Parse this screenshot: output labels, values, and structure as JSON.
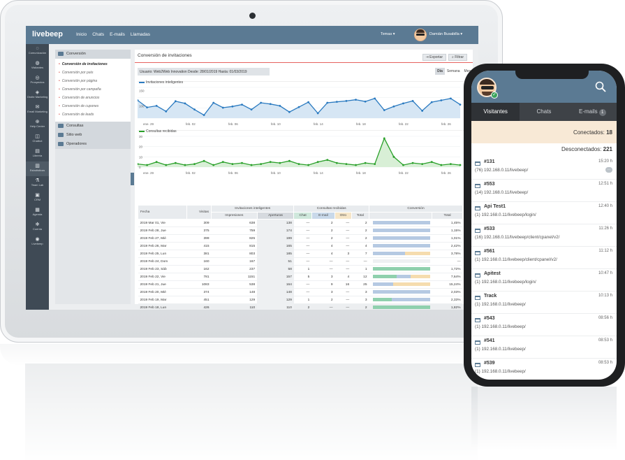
{
  "app": {
    "brand": "livebeep",
    "nav": [
      "Inicio",
      "Chats",
      "E-mails",
      "Llamadas"
    ],
    "temas": "Temas",
    "user": "Damián Busabilla"
  },
  "sidenav": [
    {
      "label": "Comunicación",
      "icon": "chat-bubble-icon"
    },
    {
      "label": "Visitantes",
      "icon": "users-icon"
    },
    {
      "label": "Prospectos",
      "icon": "people-icon"
    },
    {
      "label": "Oroite Marketing",
      "icon": "megaphone-icon"
    },
    {
      "label": "Email Marketing",
      "icon": "envelope-icon"
    },
    {
      "label": "Help Center",
      "icon": "lifebuoy-icon"
    },
    {
      "label": "Chatbot",
      "icon": "robot-icon"
    },
    {
      "label": "Librería",
      "icon": "book-icon"
    },
    {
      "label": "Estadísticas",
      "icon": "bar-chart-icon"
    },
    {
      "label": "Team Lab",
      "icon": "flask-icon"
    },
    {
      "label": "CRM",
      "icon": "crm-icon"
    },
    {
      "label": "Agenda",
      "icon": "calendar-icon"
    },
    {
      "label": "Cuenta",
      "icon": "gear-icon"
    },
    {
      "label": "Livebeep",
      "icon": "logo-icon"
    }
  ],
  "subnav": {
    "group1": "Conversión",
    "items": [
      "Conversión de invitaciones",
      "Conversión por país",
      "Conversión por página",
      "Conversión por campaña",
      "Conversión de anuncios",
      "Conversión de cupones",
      "Conversión de leads"
    ],
    "group2": "Consultas",
    "group3": "Sitio web",
    "group4": "Operadores"
  },
  "main": {
    "title": "Conversión de invitaciones",
    "export_label": "Exportar",
    "filter_label": "Filtrar",
    "filter_text": "Usuario: Web2Web Innovation   Desde: 28/01/2019   Hasta: 01/03/2019",
    "period": [
      "Día",
      "Semana",
      "Mes"
    ]
  },
  "chart_data": [
    {
      "type": "line",
      "title": "",
      "series": [
        {
          "name": "Invitaciones inteligentes",
          "color": "#2a7ac0"
        }
      ],
      "x": [
        "ene. 29",
        "feb. 02",
        "feb. 06",
        "feb. 10",
        "feb. 14",
        "feb. 18",
        "feb. 22",
        "feb. 26"
      ],
      "values": [
        118,
        95,
        100,
        82,
        115,
        108,
        88,
        70,
        110,
        94,
        98,
        104,
        88,
        110,
        106,
        100,
        80,
        96,
        112,
        76,
        110,
        113,
        116,
        120,
        114,
        124,
        86,
        98,
        108,
        116,
        84,
        112,
        118,
        124,
        104
      ],
      "yticks": [
        "100",
        "150"
      ],
      "ylim": [
        60,
        160
      ]
    },
    {
      "type": "area",
      "title": "",
      "series": [
        {
          "name": "Consultas recibidas",
          "color": "#2aa02a"
        }
      ],
      "x": [
        "ene. 29",
        "feb. 02",
        "feb. 06",
        "feb. 10",
        "feb. 14",
        "feb. 18",
        "feb. 22",
        "feb. 26"
      ],
      "values": [
        3,
        2,
        5,
        2,
        4,
        2,
        3,
        6,
        2,
        5,
        3,
        4,
        2,
        3,
        5,
        4,
        6,
        3,
        2,
        5,
        7,
        4,
        3,
        2,
        4,
        3,
        28,
        10,
        2,
        4,
        3,
        5,
        2,
        3,
        2
      ],
      "yticks": [
        "30",
        "20",
        "10",
        "0"
      ],
      "ylim": [
        0,
        30
      ]
    }
  ],
  "table": {
    "head1": [
      "Fecha",
      "Visitas",
      "Invitaciones inteligentes",
      "Consultas recibidas",
      "Conversión"
    ],
    "head2": [
      "Impresiones",
      "Aperturas",
      "Chat",
      "E-mail",
      "Otro",
      "Total",
      "Total"
    ],
    "rows": [
      {
        "fecha": "2019 Mar 01, Vie",
        "visitas": "309",
        "imp": "638",
        "ape": "138",
        "chat": "—",
        "email": "2",
        "otro": "—",
        "total": "2",
        "conv": 0.0145,
        "pct": "1,45%",
        "mix": [
          0,
          1,
          0
        ]
      },
      {
        "fecha": "2019 Feb 28, Jue",
        "visitas": "375",
        "imp": "759",
        "ape": "174",
        "chat": "—",
        "email": "2",
        "otro": "—",
        "total": "2",
        "conv": 0.0115,
        "pct": "1,15%",
        "mix": [
          0,
          1,
          0
        ]
      },
      {
        "fecha": "2019 Feb 27, Mié",
        "visitas": "399",
        "imp": "825",
        "ape": "199",
        "chat": "—",
        "email": "2",
        "otro": "—",
        "total": "2",
        "conv": 0.0101,
        "pct": "1,01%",
        "mix": [
          0,
          1,
          0
        ]
      },
      {
        "fecha": "2019 Feb 26, Mar",
        "visitas": "415",
        "imp": "815",
        "ape": "165",
        "chat": "—",
        "email": "4",
        "otro": "—",
        "total": "4",
        "conv": 0.0242,
        "pct": "2,42%",
        "mix": [
          0,
          1,
          0
        ]
      },
      {
        "fecha": "2019 Feb 25, Lun",
        "visitas": "381",
        "imp": "803",
        "ape": "185",
        "chat": "—",
        "email": "4",
        "otro": "3",
        "total": "7",
        "conv": 0.0378,
        "pct": "3,78%",
        "mix": [
          0,
          0.57,
          0.43
        ]
      },
      {
        "fecha": "2019 Feb 24, Dom",
        "visitas": "160",
        "imp": "167",
        "ape": "51",
        "chat": "—",
        "email": "—",
        "otro": "—",
        "total": "—",
        "conv": 0,
        "pct": "—",
        "mix": [
          0,
          0,
          0
        ]
      },
      {
        "fecha": "2019 Feb 23, Sáb",
        "visitas": "162",
        "imp": "237",
        "ape": "58",
        "chat": "1",
        "email": "—",
        "otro": "—",
        "total": "1",
        "conv": 0.0172,
        "pct": "1,72%",
        "mix": [
          1,
          0,
          0
        ]
      },
      {
        "fecha": "2019 Feb 22, Vie",
        "visitas": "781",
        "imp": "1151",
        "ape": "157",
        "chat": "5",
        "email": "3",
        "otro": "4",
        "total": "12",
        "conv": 0.0764,
        "pct": "7,64%",
        "mix": [
          0.42,
          0.25,
          0.33
        ]
      },
      {
        "fecha": "2019 Feb 21, Jue",
        "visitas": "1083",
        "imp": "538",
        "ape": "164",
        "chat": "—",
        "email": "9",
        "otro": "16",
        "total": "25",
        "conv": 0.1524,
        "pct": "15,24%",
        "mix": [
          0,
          0.36,
          0.64
        ]
      },
      {
        "fecha": "2019 Feb 20, Mié",
        "visitas": "374",
        "imp": "148",
        "ape": "148",
        "chat": "—",
        "email": "3",
        "otro": "—",
        "total": "3",
        "conv": 0.0203,
        "pct": "2,03%",
        "mix": [
          0,
          1,
          0
        ]
      },
      {
        "fecha": "2019 Feb 19, Mar",
        "visitas": "451",
        "imp": "129",
        "ape": "129",
        "chat": "1",
        "email": "2",
        "otro": "—",
        "total": "3",
        "conv": 0.0233,
        "pct": "2,33%",
        "mix": [
          0.33,
          0.67,
          0
        ]
      },
      {
        "fecha": "2019 Feb 18, Lun",
        "visitas": "426",
        "imp": "110",
        "ape": "110",
        "chat": "2",
        "email": "—",
        "otro": "—",
        "total": "2",
        "conv": 0.0182,
        "pct": "1,82%",
        "mix": [
          1,
          0,
          0
        ]
      }
    ]
  },
  "colors": {
    "header": "#5b7a93",
    "chat": "#8fd0ad",
    "email": "#b5c9e2",
    "otro": "#f5dcae",
    "accent_red": "#e7625f"
  },
  "phone": {
    "tabs": [
      "Visitantes",
      "Chats",
      "E-mails"
    ],
    "email_badge": "1",
    "connected_label": "Conectados:",
    "connected_count": "18",
    "disconnected_label": "Desconectados:",
    "disconnected_count": "221",
    "visitors": [
      {
        "name": "#131",
        "count": "(76)",
        "url": "192.168.0.11/livebeep/",
        "time": "15:20 h",
        "chat": true
      },
      {
        "name": "#553",
        "count": "(14)",
        "url": "192.168.0.11/livebeep/",
        "time": "12:51 h",
        "chat": false
      },
      {
        "name": "Api Test1",
        "count": "(1)",
        "url": "192.168.0.11/livebeep/login/",
        "time": "12:40 h",
        "chat": false
      },
      {
        "name": "#533",
        "count": "(16)",
        "url": "192.168.0.11/livebeep/client/cpanel/v2/",
        "time": "11:26 h",
        "chat": false
      },
      {
        "name": "#561",
        "count": "(1)",
        "url": "192.168.0.11/livebeep/client/cpanel/v2/",
        "time": "11:12 h",
        "chat": false
      },
      {
        "name": "Apitest",
        "count": "(1)",
        "url": "192.168.0.11/livebeep/login/",
        "time": "10:47 h",
        "chat": false
      },
      {
        "name": "Track",
        "count": "(1)",
        "url": "192.168.0.11/livebeep/",
        "time": "10:13 h",
        "chat": false
      },
      {
        "name": "#543",
        "count": "(1)",
        "url": "192.168.0.11/livebeep/",
        "time": "08:56 h",
        "chat": false
      },
      {
        "name": "#541",
        "count": "(1)",
        "url": "192.168.0.11/livebeep/",
        "time": "08:53 h",
        "chat": false
      },
      {
        "name": "#539",
        "count": "(1)",
        "url": "192.168.0.11/livebeep/",
        "time": "08:53 h",
        "chat": false
      }
    ]
  }
}
